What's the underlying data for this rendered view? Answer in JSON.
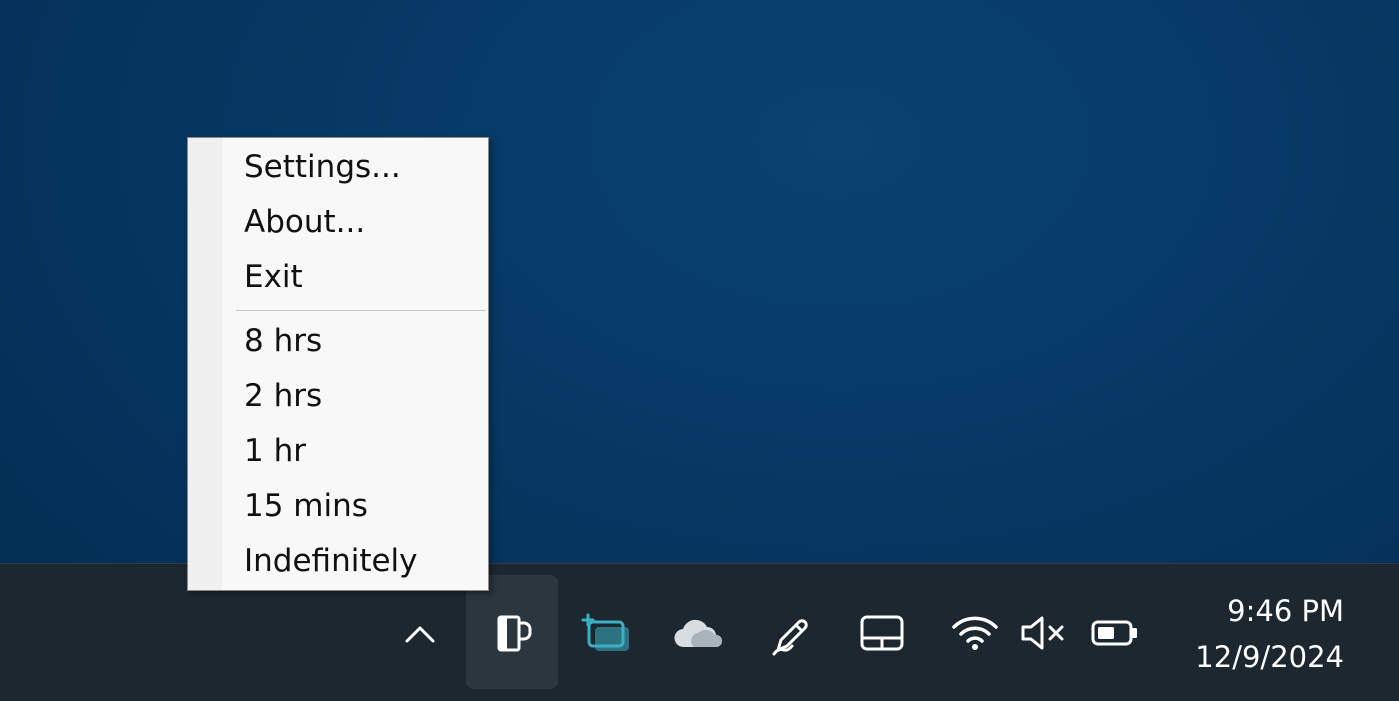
{
  "context_menu": {
    "items_top": [
      "Settings...",
      "About...",
      "Exit"
    ],
    "items_bottom": [
      "8 hrs",
      "2 hrs",
      "1 hr",
      "15 mins",
      "Indefinitely"
    ]
  },
  "tray": {
    "icons": [
      "chevron-up-icon",
      "coffee-mug-icon",
      "screen-snip-icon",
      "onedrive-cloud-icon",
      "pen-icon",
      "touchpad-icon",
      "wifi-icon",
      "volume-muted-icon",
      "battery-icon"
    ]
  },
  "clock": {
    "time": "9:46 PM",
    "date": "12/9/2024"
  },
  "colors": {
    "desktop": "#063863",
    "taskbar": "#1c2730",
    "menu_bg": "#f8f8f8",
    "snip_accent": "#3bb0c4"
  }
}
